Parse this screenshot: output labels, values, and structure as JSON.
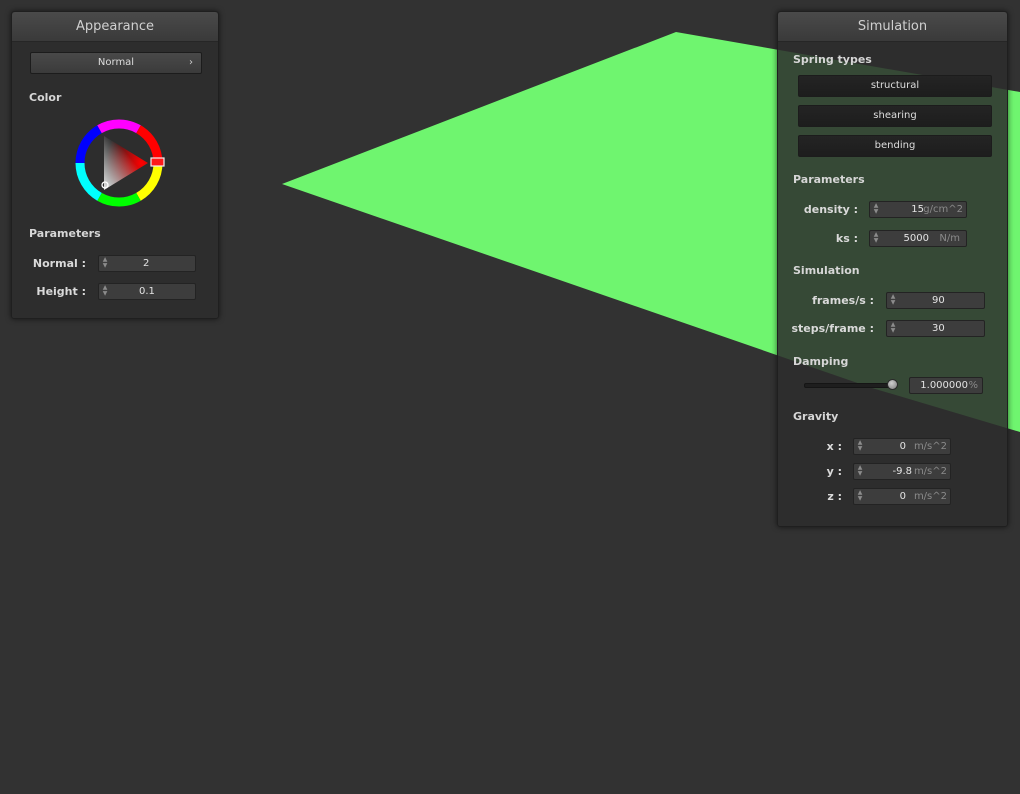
{
  "colors": {
    "background": "#323232",
    "cloth": "#6ff56f"
  },
  "appearance": {
    "title": "Appearance",
    "shader_select": "Normal",
    "color_label": "Color",
    "parameters_label": "Parameters",
    "normal_label": "Normal :",
    "normal_value": "2",
    "height_label": "Height :",
    "height_value": "0.1"
  },
  "simulation": {
    "title": "Simulation",
    "spring_types_label": "Spring types",
    "spring_structural": "structural",
    "spring_shearing": "shearing",
    "spring_bending": "bending",
    "parameters_label": "Parameters",
    "density_label": "density :",
    "density_value": "15",
    "density_unit": "g/cm^2",
    "ks_label": "ks :",
    "ks_value": "5000",
    "ks_unit": "N/m",
    "simulation_label": "Simulation",
    "fps_label": "frames/s :",
    "fps_value": "90",
    "steps_label": "steps/frame :",
    "steps_value": "30",
    "damping_label": "Damping",
    "damping_level": 1.0,
    "damping_value": "1.000000",
    "damping_unit": "%",
    "gravity_label": "Gravity",
    "gx_label": "x :",
    "gx_value": "0",
    "gy_label": "y :",
    "gy_value": "-9.8",
    "gz_label": "z :",
    "gz_value": "0",
    "gravity_unit": "m/s^2"
  }
}
